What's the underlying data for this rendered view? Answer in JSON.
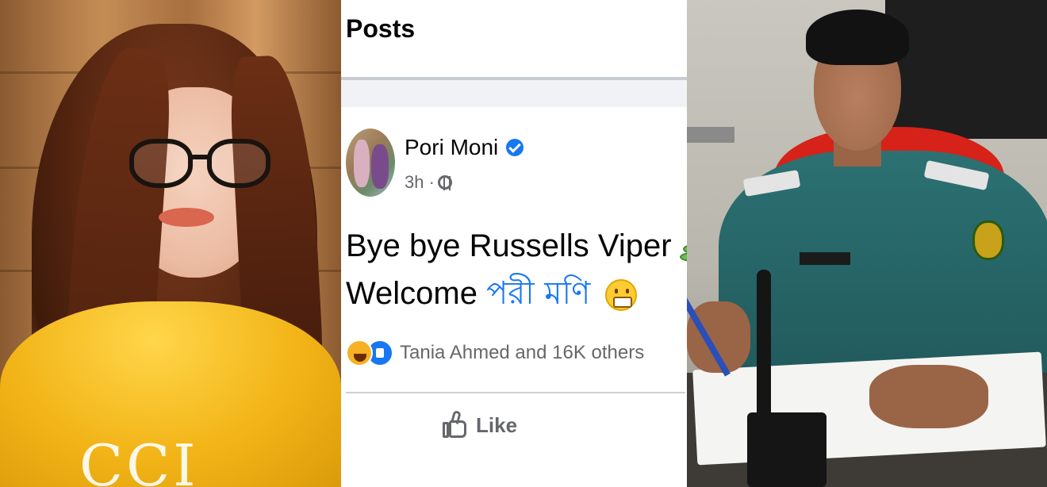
{
  "posts_header": "Posts",
  "post": {
    "author": "Pori Moni",
    "time": "3h ·",
    "text_line1": "Bye bye Russells Viper",
    "text_line2_prefix": "Welcome",
    "text_line2_link": "পরী মণি",
    "reactions_text": "Tania Ahmed and 16K others",
    "like_label": "Like"
  },
  "colors": {
    "facebook_blue": "#1877f2",
    "secondary_text": "#65676b",
    "divider": "#ced0d4"
  },
  "icons": [
    "verified-icon",
    "globe-icon",
    "snake-icon",
    "grin-icon",
    "haha-reaction-icon",
    "like-reaction-icon",
    "thumbs-up-icon"
  ]
}
